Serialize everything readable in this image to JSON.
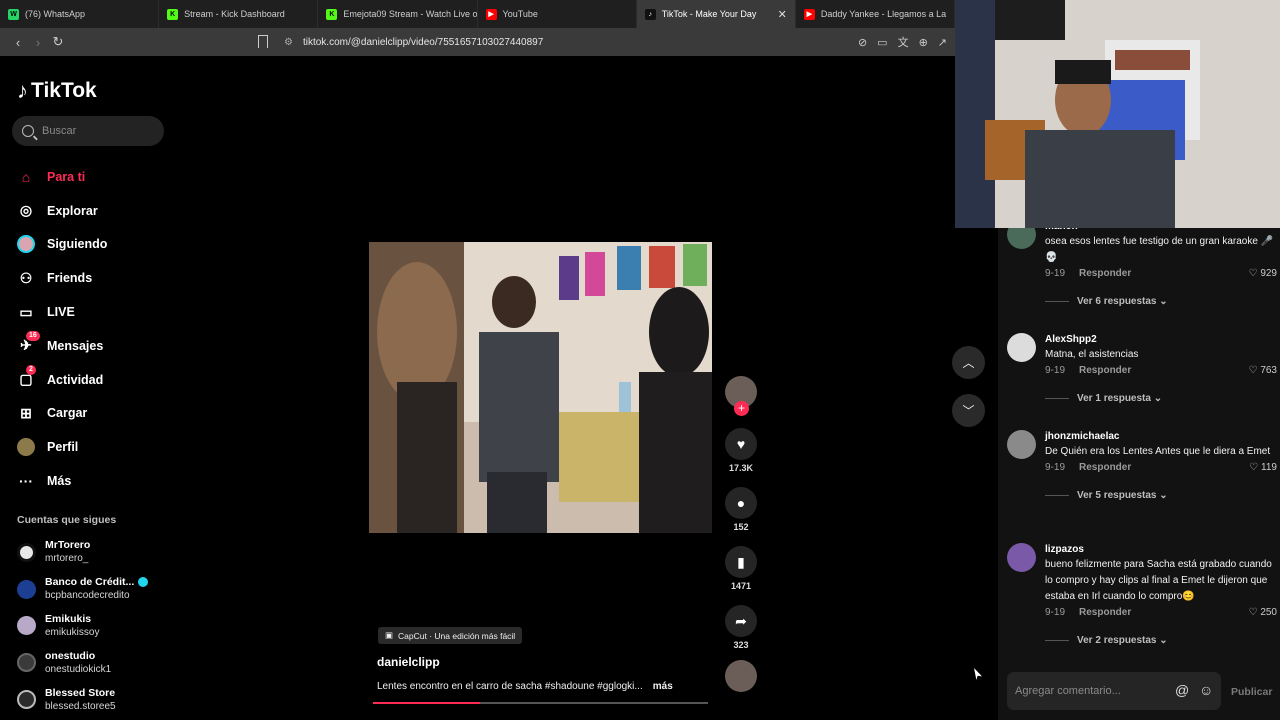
{
  "browser": {
    "tabs": [
      {
        "title": "(76) WhatsApp",
        "icon": "whatsapp-icon",
        "color": "#25d366",
        "active": false
      },
      {
        "title": "Stream - Kick Dashboard",
        "icon": "kick-icon",
        "color": "#53fc18",
        "active": false
      },
      {
        "title": "Emejota09 Stream - Watch Live on Ki",
        "icon": "kick-icon",
        "color": "#53fc18",
        "active": false
      },
      {
        "title": "YouTube",
        "icon": "youtube-icon",
        "color": "#ff0000",
        "active": false
      },
      {
        "title": "TikTok - Make Your Day",
        "icon": "tiktok-icon",
        "color": "#111111",
        "active": true
      },
      {
        "title": "Daddy Yankee - Llegamos a La",
        "icon": "youtube-icon",
        "color": "#ff0000",
        "active": false
      }
    ],
    "url": "tiktok.com/@danielclipp/video/7551657103027440897"
  },
  "sidebar": {
    "logo": "TikTok",
    "search_placeholder": "Buscar",
    "nav": [
      {
        "label": "Para ti",
        "icon": "home-icon",
        "active": true,
        "badge": ""
      },
      {
        "label": "Explorar",
        "icon": "compass-icon",
        "active": false,
        "badge": ""
      },
      {
        "label": "Siguiendo",
        "icon": "following-avatar-icon",
        "active": false,
        "badge": ""
      },
      {
        "label": "Friends",
        "icon": "friends-icon",
        "active": false,
        "badge": ""
      },
      {
        "label": "LIVE",
        "icon": "live-icon",
        "active": false,
        "badge": ""
      },
      {
        "label": "Mensajes",
        "icon": "messages-icon",
        "active": false,
        "badge": "16"
      },
      {
        "label": "Actividad",
        "icon": "activity-icon",
        "active": false,
        "badge": "2"
      },
      {
        "label": "Cargar",
        "icon": "upload-icon",
        "active": false,
        "badge": ""
      },
      {
        "label": "Perfil",
        "icon": "profile-avatar-icon",
        "active": false,
        "badge": ""
      },
      {
        "label": "Más",
        "icon": "more-icon",
        "active": false,
        "badge": ""
      }
    ],
    "following_title": "Cuentas que sigues",
    "following": [
      {
        "name": "MrTorero",
        "handle": "mrtorero_",
        "verified": false,
        "color": "#e8e8e8"
      },
      {
        "name": "Banco de Crédit...",
        "handle": "bcpbancodecredito",
        "verified": true,
        "color": "#1c3f94"
      },
      {
        "name": "Emikukis",
        "handle": "emikukissoy",
        "verified": false,
        "color": "#b8a9c9"
      },
      {
        "name": "onestudio",
        "handle": "onestudiokick1",
        "verified": false,
        "color": "#3a3a3a"
      },
      {
        "name": "Blessed Store",
        "handle": "blessed.storee5",
        "verified": false,
        "color": "#2b2b2b"
      }
    ]
  },
  "video": {
    "chip": "CapCut · Una edición más fácil",
    "author": "danielclipp",
    "description": "Lentes encontro en el carro de sacha #shadoune #gglogki...",
    "more": "más",
    "progress": 0.32
  },
  "actions": {
    "likes": "17.3K",
    "comments": "152",
    "saves": "1471",
    "shares": "323"
  },
  "comments": [
    {
      "user": "manon",
      "text": "osea esos lentes fue testigo de un gran karaoke 🎤 💀",
      "date": "9-19",
      "reply": "Responder",
      "likes": "929",
      "more": "Ver 6 respuestas",
      "color": "#4a6a5a"
    },
    {
      "user": "AlexShpp2",
      "text": "Matna, el asistencias",
      "date": "9-19",
      "reply": "Responder",
      "likes": "763",
      "more": "Ver 1 respuesta",
      "color": "#dcdcdc"
    },
    {
      "user": "jhonzmichaelac",
      "text": "De Quién era los Lentes Antes que le diera a Emet",
      "date": "9-19",
      "reply": "Responder",
      "likes": "119",
      "more": "Ver 5 respuestas",
      "color": "#8a8a8a"
    },
    {
      "user": "lizpazos",
      "text": "bueno felizmente para Sacha está grabado cuando lo compro y hay clips al final a Emet le dijeron que estaba en Irl cuando lo compro😊",
      "date": "9-19",
      "reply": "Responder",
      "likes": "250",
      "more": "Ver 2 respuestas",
      "color": "#7a5aa8"
    }
  ],
  "composer": {
    "placeholder": "Agregar comentario...",
    "publish": "Publicar"
  }
}
